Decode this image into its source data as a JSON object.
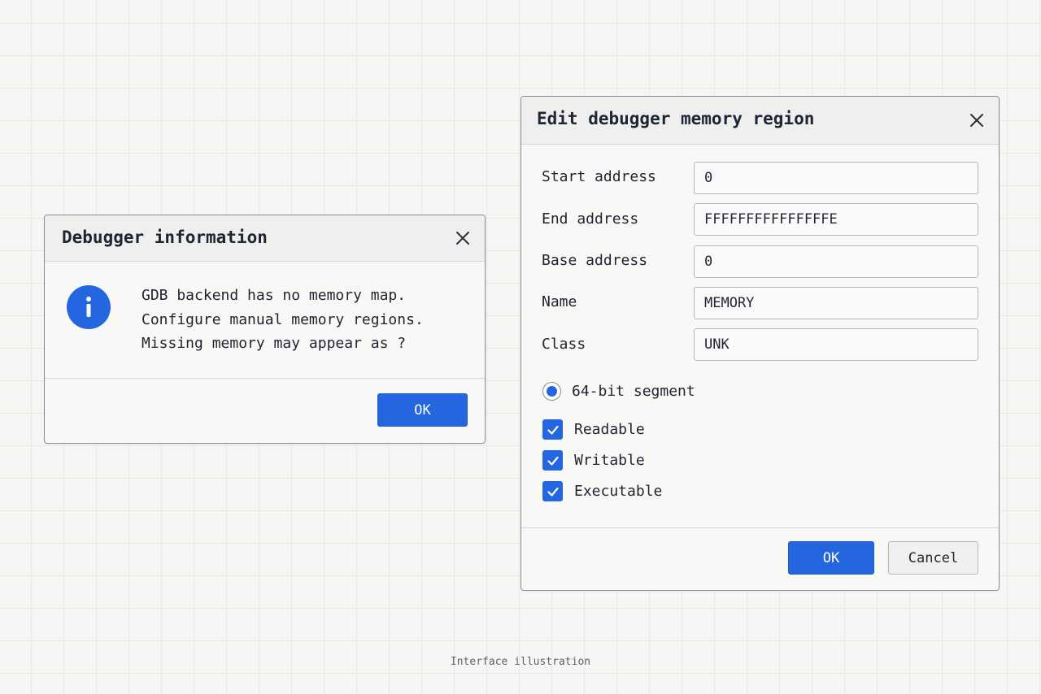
{
  "info_dialog": {
    "title": "Debugger information",
    "icon": "info-icon",
    "message_lines": [
      "GDB backend has no memory map.",
      "Configure manual memory regions.",
      "Missing memory may appear as ?"
    ],
    "ok_label": "OK"
  },
  "region_dialog": {
    "title": "Edit debugger memory region",
    "fields": {
      "start": {
        "label": "Start address",
        "value": "0"
      },
      "end": {
        "label": "End address",
        "value": "FFFFFFFFFFFFFFFE"
      },
      "base": {
        "label": "Base address",
        "value": "0"
      },
      "name": {
        "label": "Name",
        "value": "MEMORY"
      },
      "class": {
        "label": "Class",
        "value": "UNK"
      }
    },
    "segment_option": {
      "label": "64-bit segment",
      "selected": true
    },
    "permissions": {
      "readable": {
        "label": "Readable",
        "checked": true
      },
      "writable": {
        "label": "Writable",
        "checked": true
      },
      "executable": {
        "label": "Executable",
        "checked": true
      }
    },
    "ok_label": "OK",
    "cancel_label": "Cancel"
  },
  "caption": "Interface illustration",
  "colors": {
    "accent": "#2466e0",
    "background": "#f6f6f4",
    "dialog_border": "#8a8d92"
  }
}
